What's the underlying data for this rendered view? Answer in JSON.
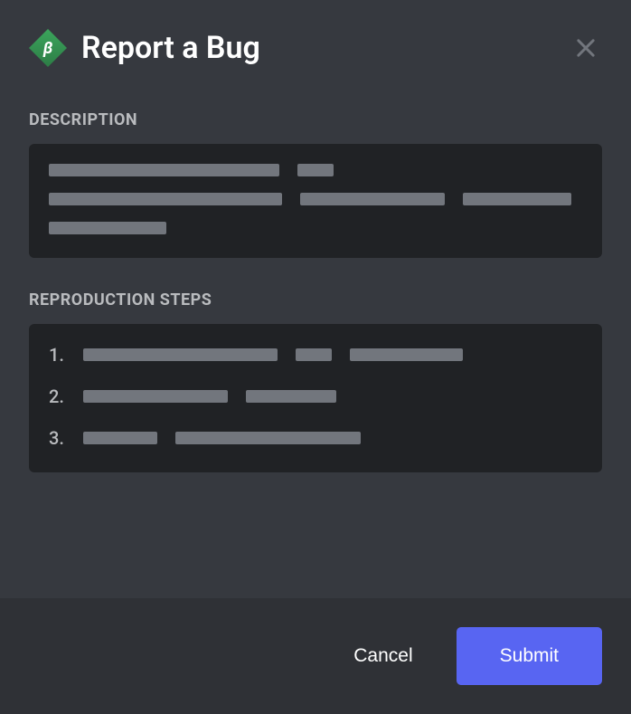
{
  "modal": {
    "title": "Report a Bug",
    "sections": {
      "description": {
        "label": "DESCRIPTION"
      },
      "reproduction": {
        "label": "REPRODUCTION STEPS",
        "steps": [
          "1.",
          "2.",
          "3."
        ]
      }
    },
    "buttons": {
      "cancel": "Cancel",
      "submit": "Submit"
    }
  }
}
